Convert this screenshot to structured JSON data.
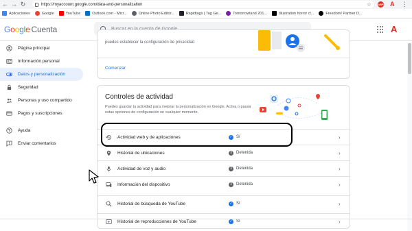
{
  "browser": {
    "url": "https://myaccount.google.com/data-and-personalization",
    "bookmarks": [
      {
        "label": "Aplicaciones",
        "color": "#4285f4"
      },
      {
        "label": "Google",
        "color": "#ea4335"
      },
      {
        "label": "YouTube",
        "color": "#ff0000"
      },
      {
        "label": "Outlook.com - Micr...",
        "color": "#0072c6"
      },
      {
        "label": "Online Photo Editor...",
        "color": "#5f6368"
      },
      {
        "label": "Rapidtags | Tag Ge...",
        "color": "#202124"
      },
      {
        "label": "Tomorrowland 201...",
        "color": "#7b1fa2"
      },
      {
        "label": "Illustration horror cl...",
        "color": "#000000"
      },
      {
        "label": "Freedom! Partner D...",
        "color": "#000000"
      }
    ],
    "ext_badge": "ABP",
    "profile_letter": "A"
  },
  "header": {
    "logo_google": "Google",
    "logo_cuenta": "Cuenta",
    "search_placeholder": "Buscar en la cuenta de Google",
    "account_letter": "A"
  },
  "sidebar": {
    "items": [
      {
        "label": "Página principal",
        "icon": "person-circle-icon"
      },
      {
        "label": "Información personal",
        "icon": "id-card-icon"
      },
      {
        "label": "Datos y personalización",
        "icon": "toggle-icon"
      },
      {
        "label": "Seguridad",
        "icon": "lock-icon"
      },
      {
        "label": "Personas y uso compartido",
        "icon": "people-icon"
      },
      {
        "label": "Pagos y suscripciones",
        "icon": "credit-card-icon"
      },
      {
        "label": "Ayuda",
        "icon": "help-icon"
      },
      {
        "label": "Enviar comentarios",
        "icon": "feedback-icon"
      }
    ]
  },
  "privacy_card": {
    "description": "puedes establecer la configuración de privacidad",
    "link": "Comenzar"
  },
  "activity_card": {
    "title": "Controles de actividad",
    "subtitle": "Puedes guardar tu actividad para mejorar la personalización en Google. Activa o pausa estas opciones de configuración en cualquier momento.",
    "rows": [
      {
        "label": "Actividad web y de aplicaciones",
        "status": "Sí",
        "on": true,
        "icon": "history-icon"
      },
      {
        "label": "Historial de ubicaciones",
        "status": "Detenida",
        "on": false,
        "icon": "location-pin-icon"
      },
      {
        "label": "Actividad de voz y audio",
        "status": "Detenida",
        "on": false,
        "icon": "microphone-icon"
      },
      {
        "label": "Información del dispositivo",
        "status": "Detenida",
        "on": false,
        "icon": "device-icon"
      },
      {
        "label": "Historial de búsqueda de YouTube",
        "status": "Sí",
        "on": true,
        "icon": "search-icon"
      },
      {
        "label": "Historial de reproducciones de YouTube",
        "status": "Sí",
        "on": true,
        "icon": "play-icon"
      }
    ]
  },
  "colors": {
    "accent": "#1a73e8",
    "active_bg": "#e8f0fe",
    "paused": "#5f6368"
  }
}
